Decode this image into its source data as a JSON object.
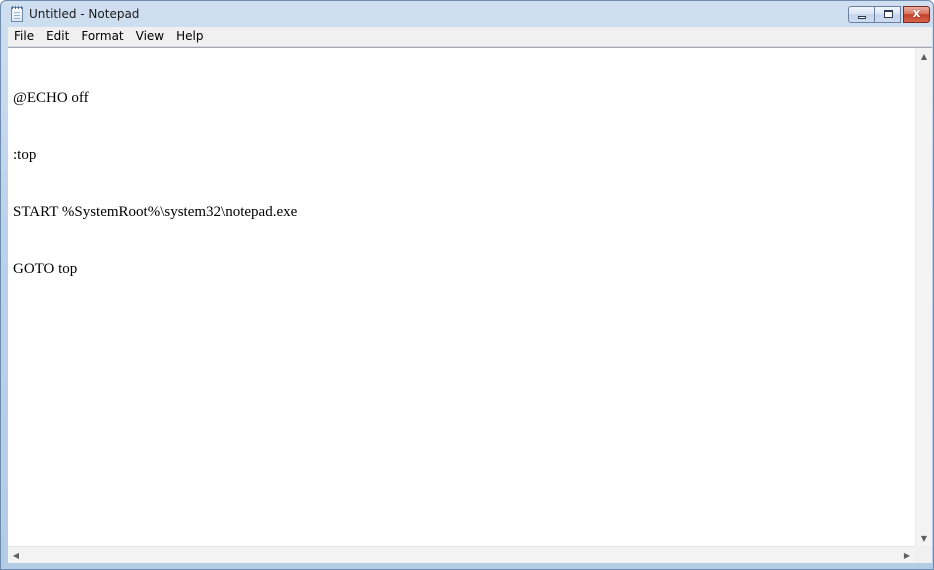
{
  "window": {
    "title": "Untitled - Notepad",
    "icon": "notepad-icon",
    "controls": {
      "close_glyph": "x"
    }
  },
  "menu": {
    "items": [
      {
        "label": "File"
      },
      {
        "label": "Edit"
      },
      {
        "label": "Format"
      },
      {
        "label": "View"
      },
      {
        "label": "Help"
      }
    ]
  },
  "document": {
    "lines": [
      "@ECHO off",
      ":top",
      "START %SystemRoot%\\system32\\notepad.exe",
      "GOTO top"
    ]
  },
  "scrollbars": {
    "up_arrow": "▲",
    "down_arrow": "▼",
    "left_arrow": "◀",
    "right_arrow": "▶"
  },
  "colors": {
    "frame": "#b9cfe8",
    "close_button": "#c4402a",
    "menu_background": "#f0f0f0",
    "editor_background": "#ffffff"
  }
}
